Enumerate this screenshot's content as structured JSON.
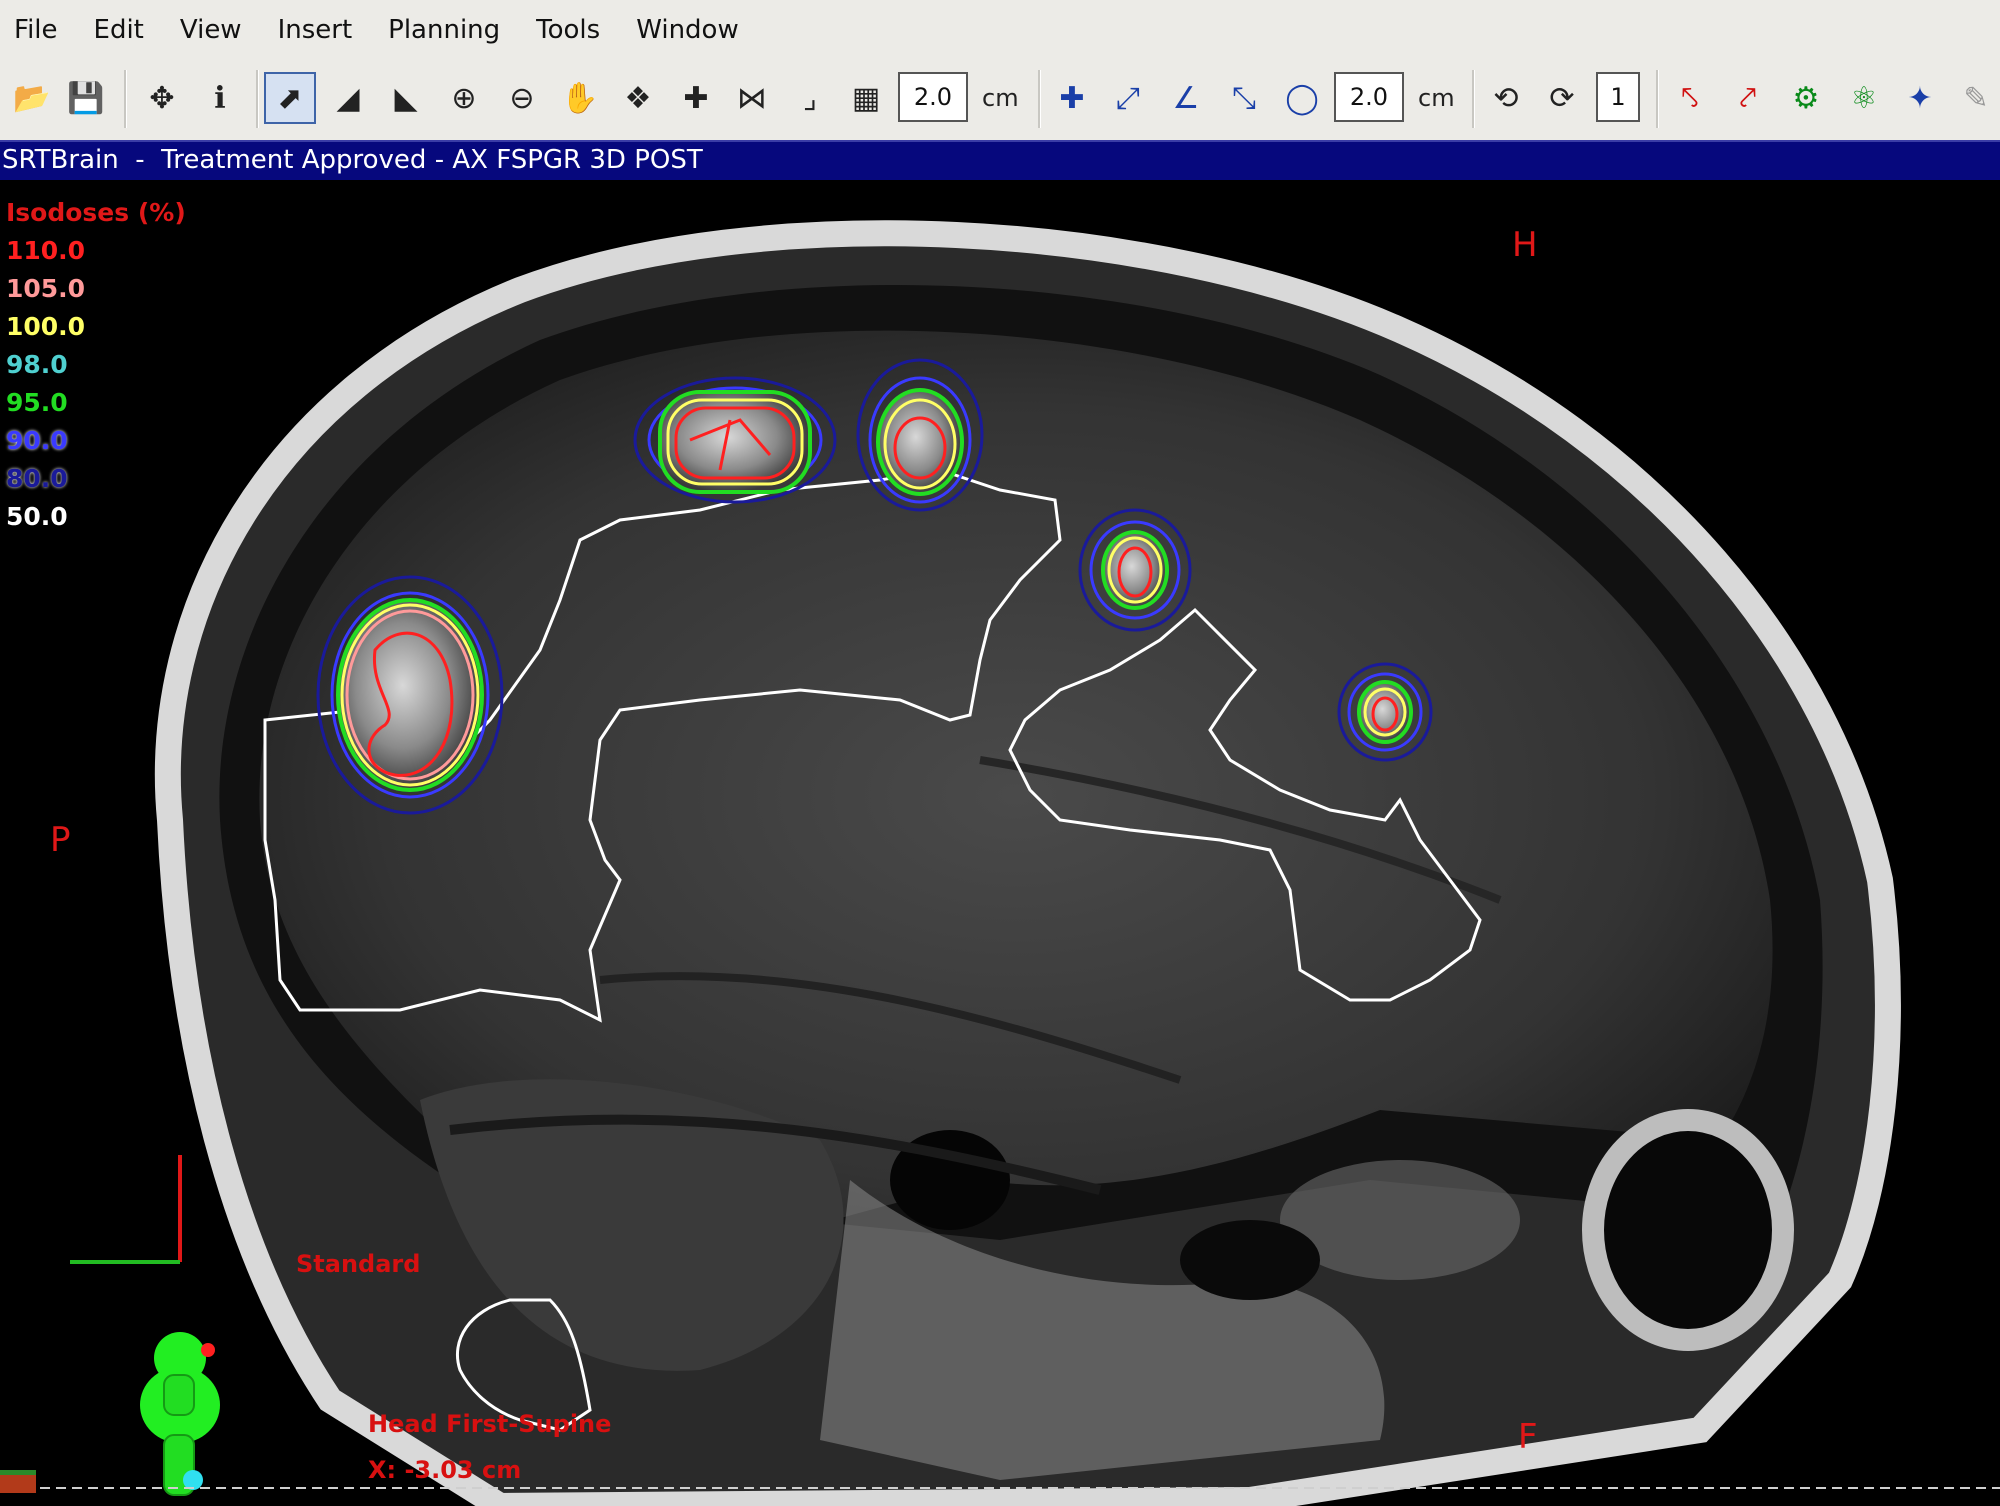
{
  "menu": [
    "File",
    "Edit",
    "View",
    "Insert",
    "Planning",
    "Tools",
    "Window"
  ],
  "toolbar": {
    "grid_size_1": "2.0",
    "unit_1": "cm",
    "grid_size_2": "2.0",
    "unit_2": "cm",
    "slice_count": "1",
    "info_label": "i"
  },
  "window_title": "SRTBrain  -  Treatment Approved - AX FSPGR 3D POST",
  "isodoses": {
    "title": "Isodoses (%)",
    "levels": [
      {
        "value": "110.0",
        "color": "#ff2020"
      },
      {
        "value": "105.0",
        "color": "#ff9a9a"
      },
      {
        "value": "100.0",
        "color": "#ffff66"
      },
      {
        "value": "98.0",
        "color": "#4fd0d0"
      },
      {
        "value": "95.0",
        "color": "#22dd22"
      },
      {
        "value": "90.0",
        "color": "#3a3aff"
      },
      {
        "value": "80.0",
        "color": "#1a1a9a"
      },
      {
        "value": "50.0",
        "color": "#ffffff"
      }
    ]
  },
  "orientation": {
    "head": "H",
    "posterior": "P",
    "feet": "F"
  },
  "view_label": "Standard",
  "patient_position": "Head First-Supine",
  "slice_position": "X: -3.03 cm",
  "colors": {
    "titlebar": "#06087d",
    "menu_bg": "#ecebe7",
    "annotation": "#d81010"
  }
}
